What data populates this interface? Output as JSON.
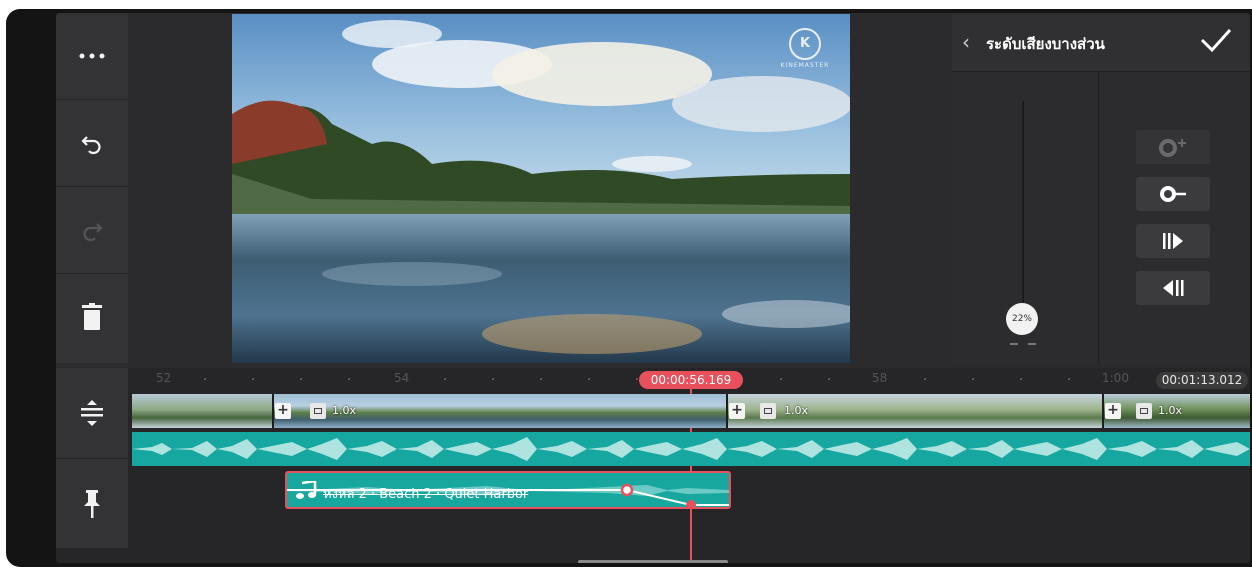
{
  "toolbar": {
    "more_icon": "more-dots-icon",
    "undo_icon": "undo-icon",
    "redo_icon": "redo-icon",
    "delete_icon": "trash-icon"
  },
  "preview": {
    "watermark_logo": "K",
    "watermark_text": "KINEMASTER"
  },
  "panel": {
    "back_symbol": "‹",
    "title": "ระดับเสียงบางส่วน",
    "confirm_icon": "checkmark-icon",
    "volume_value": "22%",
    "buttons": [
      {
        "name": "add-keyframe",
        "icon": "keyframe-add-icon"
      },
      {
        "name": "remove-keyframe",
        "icon": "keyframe-remove-icon"
      },
      {
        "name": "next-keyframe",
        "icon": "next-keyframe-icon"
      },
      {
        "name": "previous-keyframe",
        "icon": "previous-keyframe-icon"
      }
    ]
  },
  "timeline": {
    "ruler_labels": [
      "52",
      "54",
      "58",
      "1:00"
    ],
    "playhead_time": "00:00:56.169",
    "total_time": "00:01:13.012",
    "clip_speed_labels": [
      "1.0x",
      "1.0x",
      "1.0x"
    ],
    "music_clip_title": "หงหล 2 · Beach 2 · Quiet Harbor",
    "side_tools": [
      "timeline-expand-icon",
      "pin-icon"
    ]
  },
  "colors": {
    "accent": "#e8505b",
    "audio": "#16a8a0",
    "background": "#2b2b2d"
  }
}
